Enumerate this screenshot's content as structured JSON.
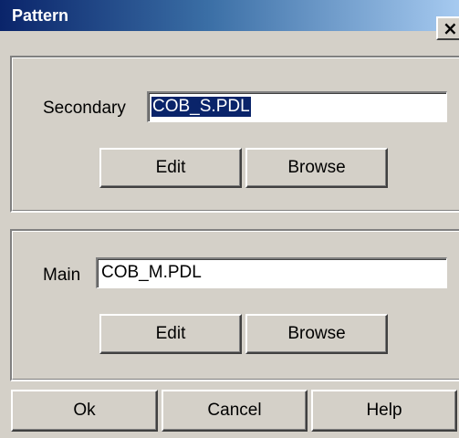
{
  "window": {
    "title": "Pattern",
    "close_glyph": "×"
  },
  "secondary": {
    "label": "Secondary",
    "value": "COB_S.PDL",
    "edit_label": "Edit",
    "browse_label": "Browse"
  },
  "main": {
    "label": "Main",
    "value": "COB_M.PDL",
    "edit_label": "Edit",
    "browse_label": "Browse"
  },
  "footer": {
    "ok_label": "Ok",
    "cancel_label": "Cancel",
    "help_label": "Help"
  },
  "colors": {
    "title_gradient_start": "#0a246a",
    "title_gradient_end": "#a6caf0",
    "dialog_face": "#d4d0c8",
    "selection": "#0a246a"
  }
}
